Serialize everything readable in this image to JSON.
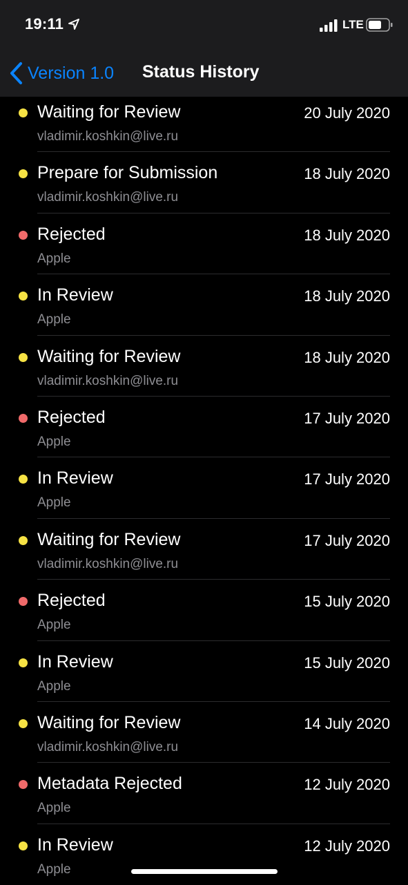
{
  "status_bar": {
    "time": "19:11",
    "network": "LTE",
    "icons": [
      "location-arrow-icon",
      "signal-icon",
      "battery-icon"
    ]
  },
  "nav": {
    "back_label": "Version 1.0",
    "title": "Status History"
  },
  "colors": {
    "accent": "#0a84ff",
    "status_yellow": "#f6e244",
    "status_red": "#f06a6a",
    "secondary_text": "#8e8e93"
  },
  "history": [
    {
      "status": "Waiting for Review",
      "by": "vladimir.koshkin@live.ru",
      "date": "20 July 2020",
      "color": "yellow"
    },
    {
      "status": "Prepare for Submission",
      "by": "vladimir.koshkin@live.ru",
      "date": "18 July 2020",
      "color": "yellow"
    },
    {
      "status": "Rejected",
      "by": "Apple",
      "date": "18 July 2020",
      "color": "red"
    },
    {
      "status": "In Review",
      "by": "Apple",
      "date": "18 July 2020",
      "color": "yellow"
    },
    {
      "status": "Waiting for Review",
      "by": "vladimir.koshkin@live.ru",
      "date": "18 July 2020",
      "color": "yellow"
    },
    {
      "status": "Rejected",
      "by": "Apple",
      "date": "17 July 2020",
      "color": "red"
    },
    {
      "status": "In Review",
      "by": "Apple",
      "date": "17 July 2020",
      "color": "yellow"
    },
    {
      "status": "Waiting for Review",
      "by": "vladimir.koshkin@live.ru",
      "date": "17 July 2020",
      "color": "yellow"
    },
    {
      "status": "Rejected",
      "by": "Apple",
      "date": "15 July 2020",
      "color": "red"
    },
    {
      "status": "In Review",
      "by": "Apple",
      "date": "15 July 2020",
      "color": "yellow"
    },
    {
      "status": "Waiting for Review",
      "by": "vladimir.koshkin@live.ru",
      "date": "14 July 2020",
      "color": "yellow"
    },
    {
      "status": "Metadata Rejected",
      "by": "Apple",
      "date": "12 July 2020",
      "color": "red"
    },
    {
      "status": "In Review",
      "by": "Apple",
      "date": "12 July 2020",
      "color": "yellow"
    }
  ]
}
